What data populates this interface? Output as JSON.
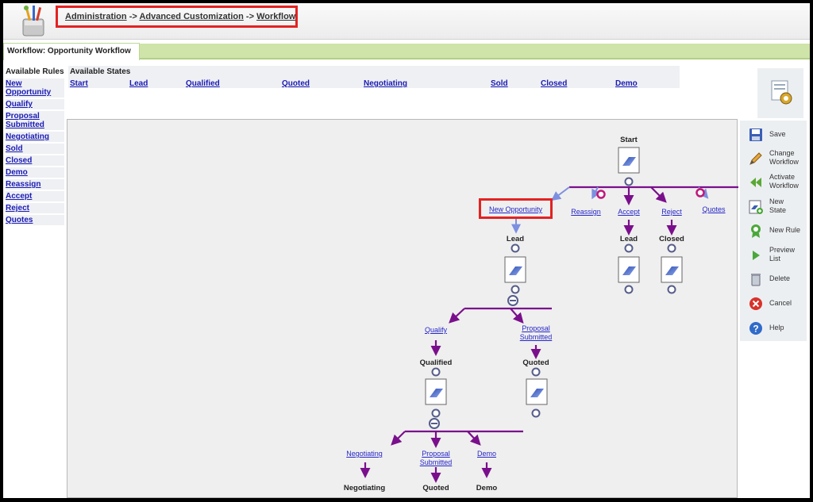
{
  "breadcrumb": {
    "item1": "Administration",
    "sep1": "->",
    "item2": "Advanced Customization",
    "sep2": "->",
    "item3": "Workflow"
  },
  "tab": {
    "label": "Workflow: Opportunity Workflow"
  },
  "rules": {
    "title": "Available Rules",
    "items": [
      {
        "label": "New Opportunity"
      },
      {
        "label": "Qualify"
      },
      {
        "label": "Proposal Submitted"
      },
      {
        "label": "Negotiating"
      },
      {
        "label": "Sold"
      },
      {
        "label": "Closed"
      },
      {
        "label": "Demo"
      },
      {
        "label": "Reassign"
      },
      {
        "label": "Accept"
      },
      {
        "label": "Reject"
      },
      {
        "label": "Quotes"
      }
    ]
  },
  "states": {
    "title": "Available States",
    "items": [
      {
        "label": "Start"
      },
      {
        "label": "Lead"
      },
      {
        "label": "Qualified"
      },
      {
        "label": "Quoted"
      },
      {
        "label": "Negotiating"
      },
      {
        "label": "Sold"
      },
      {
        "label": "Closed"
      },
      {
        "label": "Demo"
      }
    ]
  },
  "diagram": {
    "start": "Start",
    "top_rules": {
      "new_opportunity": "New Opportunity",
      "reassign": "Reassign",
      "accept": "Accept",
      "reject": "Reject",
      "quotes": "Quotes"
    },
    "top_states": {
      "lead": "Lead",
      "accept_lead": "Lead",
      "closed": "Closed"
    },
    "lead_rules": {
      "qualify": "Qualify",
      "proposal_submitted": "Proposal Submitted"
    },
    "lead_states": {
      "qualified": "Qualified",
      "quoted": "Quoted"
    },
    "qualified_rules": {
      "negotiating": "Negotiating",
      "proposal_submitted": "Proposal Submitted",
      "demo": "Demo"
    },
    "qualified_states": {
      "negotiating": "Negotiating",
      "quoted": "Quoted",
      "demo": "Demo"
    }
  },
  "toolbar": {
    "save": "Save",
    "change_workflow": "Change Workflow",
    "activate_workflow": "Activate Workflow",
    "new_state": "New State",
    "new_rule": "New Rule",
    "preview_list": "Preview List",
    "delete": "Delete",
    "cancel": "Cancel",
    "help": "Help"
  },
  "colors": {
    "highlight": "#e32222",
    "link": "#1a1ab4",
    "flow": "#7a0f8c",
    "tab_strip": "#cfe4a8"
  }
}
